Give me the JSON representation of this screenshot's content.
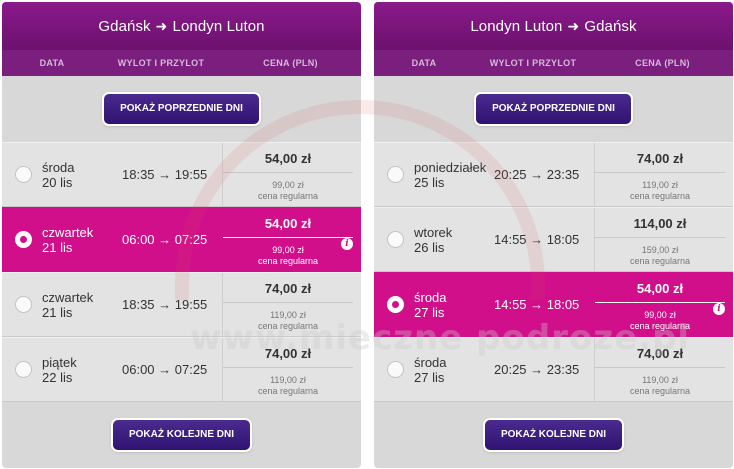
{
  "columns": {
    "date": "DATA",
    "times": "WYLOT I PRZYLOT",
    "price": "CENA (PLN)"
  },
  "buttons": {
    "prev": "POKAŻ POPRZEDNIE DNI",
    "next": "POKAŻ KOLEJNE DNI"
  },
  "regular_label": "cena regularna",
  "watermark": "www.mieczne podroze.pl",
  "colors": {
    "header": "#7a1f7d",
    "selected": "#d10f8a",
    "button": "#3a1c80"
  },
  "outbound": {
    "from": "Gdańsk",
    "to": "Londyn Luton",
    "rows": [
      {
        "day": "środa",
        "date": "20 lis",
        "times": "18:35 → 19:55",
        "price": "54,00 zł",
        "regular": "99,00 zł",
        "selected": false
      },
      {
        "day": "czwartek",
        "date": "21 lis",
        "times": "06:00 → 07:25",
        "price": "54,00 zł",
        "regular": "99,00 zł",
        "selected": true
      },
      {
        "day": "czwartek",
        "date": "21 lis",
        "times": "18:35 → 19:55",
        "price": "74,00 zł",
        "regular": "119,00 zł",
        "selected": false
      },
      {
        "day": "piątek",
        "date": "22 lis",
        "times": "06:00 → 07:25",
        "price": "74,00 zł",
        "regular": "119,00 zł",
        "selected": false
      }
    ]
  },
  "return": {
    "from": "Londyn Luton",
    "to": "Gdańsk",
    "rows": [
      {
        "day": "poniedziałek",
        "date": "25 lis",
        "times": "20:25 → 23:35",
        "price": "74,00 zł",
        "regular": "119,00 zł",
        "selected": false
      },
      {
        "day": "wtorek",
        "date": "26 lis",
        "times": "14:55 → 18:05",
        "price": "114,00 zł",
        "regular": "159,00 zł",
        "selected": false
      },
      {
        "day": "środa",
        "date": "27 lis",
        "times": "14:55 → 18:05",
        "price": "54,00 zł",
        "regular": "99,00 zł",
        "selected": true
      },
      {
        "day": "środa",
        "date": "27 lis",
        "times": "20:25 → 23:35",
        "price": "74,00 zł",
        "regular": "119,00 zł",
        "selected": false
      }
    ]
  }
}
